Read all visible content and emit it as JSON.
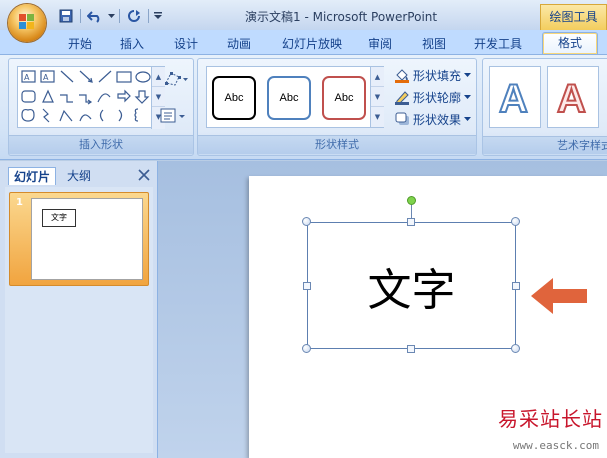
{
  "window": {
    "title": "演示文稿1 - Microsoft PowerPoint",
    "contextual_title": "绘图工具"
  },
  "quick_access": [
    "save-icon",
    "undo-icon",
    "dropdown-arrow-icon",
    "redo-icon",
    "customize-qat-icon"
  ],
  "tabs": [
    {
      "label": "开始"
    },
    {
      "label": "插入"
    },
    {
      "label": "设计"
    },
    {
      "label": "动画"
    },
    {
      "label": "幻灯片放映"
    },
    {
      "label": "审阅"
    },
    {
      "label": "视图"
    },
    {
      "label": "开发工具"
    },
    {
      "label": "格式",
      "active": true
    }
  ],
  "ribbon": {
    "insert_shapes": {
      "label": "插入形状"
    },
    "shape_styles": {
      "label": "形状样式",
      "sample_text": "Abc",
      "fill": "形状填充",
      "outline": "形状轮廓",
      "effects": "形状效果",
      "colors": [
        "#000000",
        "#4f81bd",
        "#c0504d"
      ]
    },
    "wordart": {
      "label": "艺术字样式",
      "sample": "A"
    }
  },
  "left_pane": {
    "tabs": [
      {
        "label": "幻灯片",
        "active": true
      },
      {
        "label": "大纲"
      }
    ],
    "slide_number": "1",
    "thumb_text": "文字"
  },
  "slide": {
    "text": "文字"
  },
  "watermark": {
    "text": "易采站长站",
    "url": "www.easck.com"
  },
  "colors": {
    "arrow": "#e0643c",
    "accent_orange": "#f1a43f"
  }
}
